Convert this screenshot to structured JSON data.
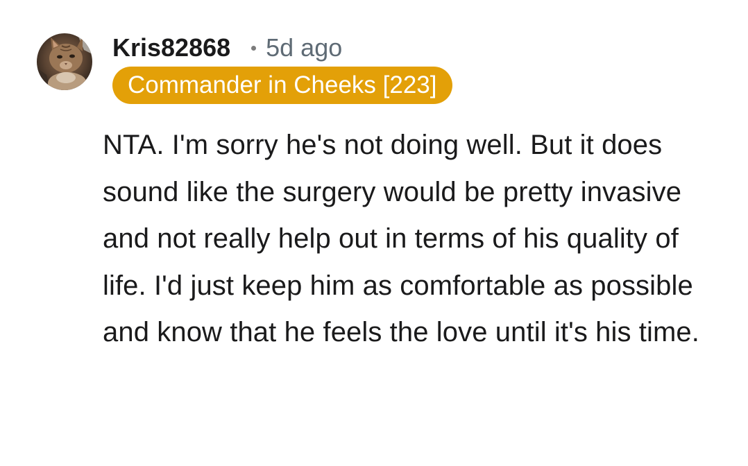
{
  "comment": {
    "author": "Kris82868",
    "timestamp": "5d ago",
    "flair": "Commander in Cheeks [223]",
    "avatar_icon": "cat-avatar-icon",
    "body": "NTA. I'm sorry he's not doing well. But it does sound like the surgery would be pretty invasive and not really help out in terms of his quality of life. I'd just keep him as comfortable as possible and know that he feels the love until it's his time."
  },
  "colors": {
    "flair_background": "#e3a008",
    "flair_text": "#ffffff",
    "username": "#1a1a1b",
    "timestamp": "#5f6b75",
    "body_text": "#1a1a1b"
  }
}
